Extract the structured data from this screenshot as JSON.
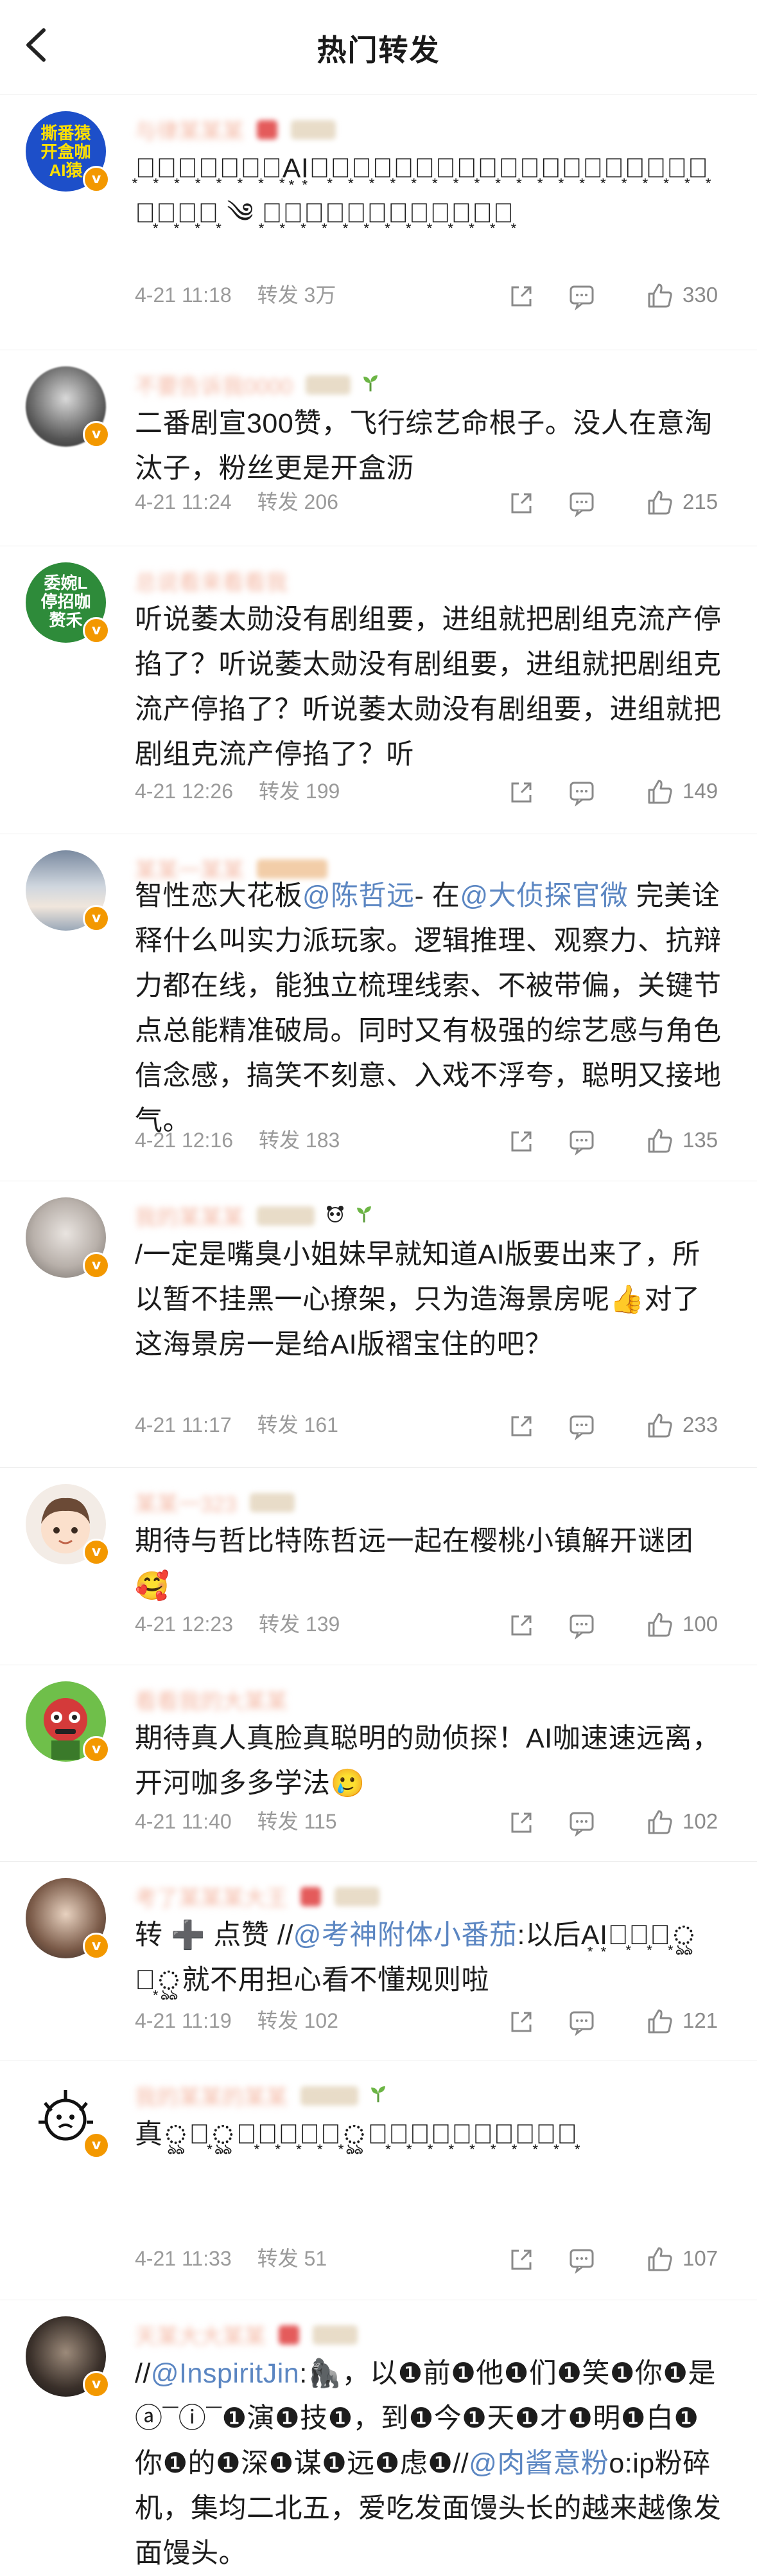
{
  "header": {
    "title": "热门转发"
  },
  "comments": [
    {
      "avatar_text": "撕番猿\n开盒咖\nAI猿",
      "username": "与律某某某",
      "text": "͙褶͙猿͙本͙人͙还͙没͙有͙A͙I͙有͙存͙在͙感͙，͙上͙了͙这͙么͙多͙期͙最͙火͙还͙是͙粉͙丝͙推͙搡͙女͙艺͙人͙。͙ ༄ ͙来͙了͙多͙少͙期͙了͙归͙来͙仍͙是͙新͙人͙",
      "time": "4-21 11:18",
      "forward": "转发 3万",
      "likes": "330"
    },
    {
      "username": "不要告诉我0000",
      "text": "二番剧宣300赞，飞行综艺命根子。没人在意淘汰子，粉丝更是开盒沥",
      "time": "4-21 11:24",
      "forward": "转发 206",
      "likes": "215"
    },
    {
      "avatar_text": "委婉L\n停招咖\n赘禾",
      "username": "总说看来看看我",
      "text": "听说萎太勋没有剧组要，进组就把剧组克流产停掐了？听说萎太勋没有剧组要，进组就把剧组克流产停掐了？听说萎太勋没有剧组要，进组就把剧组克流产停掐了？听",
      "time": "4-21 12:26",
      "forward": "转发 199",
      "likes": "149"
    },
    {
      "username": "某某一某某",
      "text_parts": [
        "智性恋大花板",
        "@陈哲远",
        "- 在",
        "@大侦探官微",
        " 完美诠释什么叫实力派玩家。逻辑推理、观察力、抗辩力都在线，能独立梳理线索、不被带偏，关键节点总能精准破局。同时又有极强的综艺感与角色信念感，搞笑不刻意、入戏不浮夸，聪明又接地气。"
      ],
      "time": "4-21 12:16",
      "forward": "转发 183",
      "likes": "135"
    },
    {
      "username": "我的某某某",
      "text": "/一定是嘴臭小姐妹早就知道AI版要出来了，所以暂不挂黑一心撩架，只为造海景房呢👍对了这海景房一是给AI版褶宝住的吧？",
      "time": "4-21 11:17",
      "forward": "转发 161",
      "likes": "233"
    },
    {
      "username": "某某一323",
      "text": "期待与哲比特陈哲远一起在樱桃小镇解开谜团 🥰",
      "time": "4-21 12:23",
      "forward": "转发 139",
      "likes": "100"
    },
    {
      "username": "看看我的大某某",
      "text": "期待真人真脸真聪明的勋侦探！AI咖速速远离，开河咖多多学法🥲",
      "time": "4-21 11:40",
      "forward": "转发 115",
      "likes": "102"
    },
    {
      "username": "考了某某某大王",
      "text_parts": [
        "转 ➕ 点赞 //",
        "@考神附体小番茄",
        ":以后A͙I͙电͙子͙艺͙ৣ猿͙ৣ就不用担心看不懂规则啦"
      ],
      "time": "4-21 11:19",
      "forward": "转发 102",
      "likes": "121"
    },
    {
      "username": "我的某某的某某",
      "text": "真ৣ人͙ৣ都͙没͙人͙看͙的͙ৣ竹͙脸͙还͙送͙进͙副͙里͙追͙着͙鲨͙",
      "time": "4-21 11:33",
      "forward": "转发 51",
      "likes": "107"
    },
    {
      "username": "天某大大某某",
      "text_parts": [
        "//",
        "@InspiritJin",
        ":🦍，以❶前❶他❶们❶笑❶你❶是ⓐ¯ⓘ¯❶演❶技❶，到❶今❶天❶才❶明❶白❶你❶的❶深❶谋❶远❶虑❶//",
        "@肉酱意粉",
        "o:ip粉碎机，集均二北五，爱吃发面馒头长的越来越像发面馒头。"
      ],
      "time": "",
      "forward": "",
      "likes": ""
    }
  ],
  "icons": {
    "back": "chevron-left-icon",
    "share": "share-icon",
    "comment": "comment-icon",
    "like": "thumb-up-icon",
    "verified": "verified-badge-icon"
  },
  "colors": {
    "mention": "#5b86c2",
    "meta": "#9a9a9a",
    "badge": "#f39800"
  }
}
